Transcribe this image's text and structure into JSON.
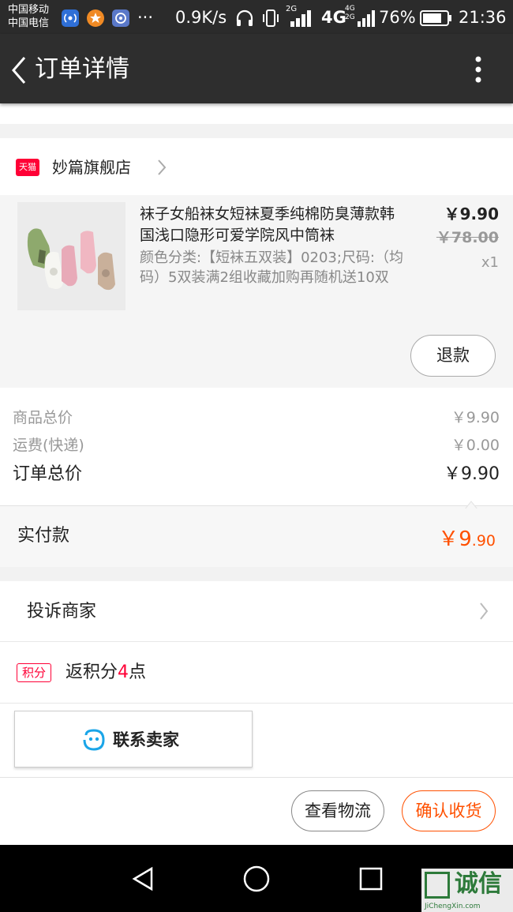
{
  "status_bar": {
    "carrier_1": "中国移动",
    "carrier_2": "中国电信",
    "more": "···",
    "speed": "0.9K/s",
    "net_2g": "2G",
    "net_4g": "4G",
    "battery": "76%",
    "time": "21:36"
  },
  "app_bar": {
    "title": "订单详情"
  },
  "shop": {
    "badge": "天猫",
    "name": "妙篇旗舰店"
  },
  "item": {
    "title": "袜子女船袜女短袜夏季纯棉防臭薄款韩国浅口隐形可爱学院风中筒袜",
    "sku": "颜色分类:【短袜五双装】0203;尺码:（均码）5双装满2组收藏加购再随机送10双",
    "price": "￥9.90",
    "original_price": "￥78.00",
    "quantity": "x1",
    "refund_button": "退款"
  },
  "summary": {
    "goods_total_label": "商品总价",
    "goods_total_value": "￥9.90",
    "shipping_label": "运费(快递)",
    "shipping_value": "￥0.00",
    "order_total_label": "订单总价",
    "order_total_value": "￥9.90"
  },
  "payment": {
    "label": "实付款",
    "currency_and_int": "￥9",
    "decimal": ".90"
  },
  "actions": {
    "complain": "投诉商家",
    "points_badge": "积分",
    "points_prefix": "返积分",
    "points_value": "4",
    "points_suffix": "点",
    "contact": "联系卖家"
  },
  "footer": {
    "logistics_button": "查看物流",
    "confirm_button": "确认收货"
  },
  "watermark": {
    "text": "诚信",
    "url": "JiChengXin.com"
  },
  "colors": {
    "accent_orange": "#ff5000",
    "tmall_red": "#ff0036",
    "header_bg": "#2e2e2e"
  }
}
